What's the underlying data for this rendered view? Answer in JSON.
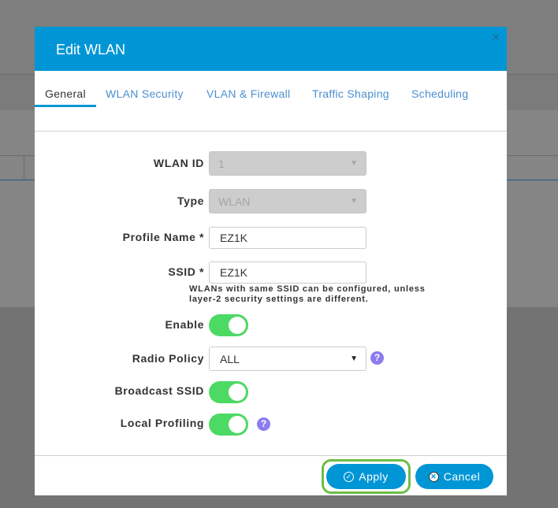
{
  "dialog": {
    "title": "Edit WLAN"
  },
  "tabs": [
    "General",
    "WLAN Security",
    "VLAN & Firewall",
    "Traffic Shaping",
    "Scheduling"
  ],
  "form": {
    "wlan_id": {
      "label": "WLAN ID",
      "value": "1"
    },
    "type": {
      "label": "Type",
      "value": "WLAN"
    },
    "profile_name": {
      "label": "Profile Name *",
      "value": "EZ1K"
    },
    "ssid": {
      "label": "SSID *",
      "value": "EZ1K",
      "hint1": "WLANs with same SSID can be configured, unless",
      "hint2": "layer-2 security settings are different."
    },
    "enable": {
      "label": "Enable",
      "on": true
    },
    "radio_policy": {
      "label": "Radio Policy",
      "value": "ALL"
    },
    "broadcast_ssid": {
      "label": "Broadcast SSID",
      "on": true
    },
    "local_profiling": {
      "label": "Local Profiling",
      "on": true
    }
  },
  "footer": {
    "apply": "Apply",
    "cancel": "Cancel"
  },
  "colors": {
    "header": "#0096d6",
    "toggle_on": "#4cd964",
    "help": "#8a7cf0",
    "highlight": "#6dbd45"
  }
}
